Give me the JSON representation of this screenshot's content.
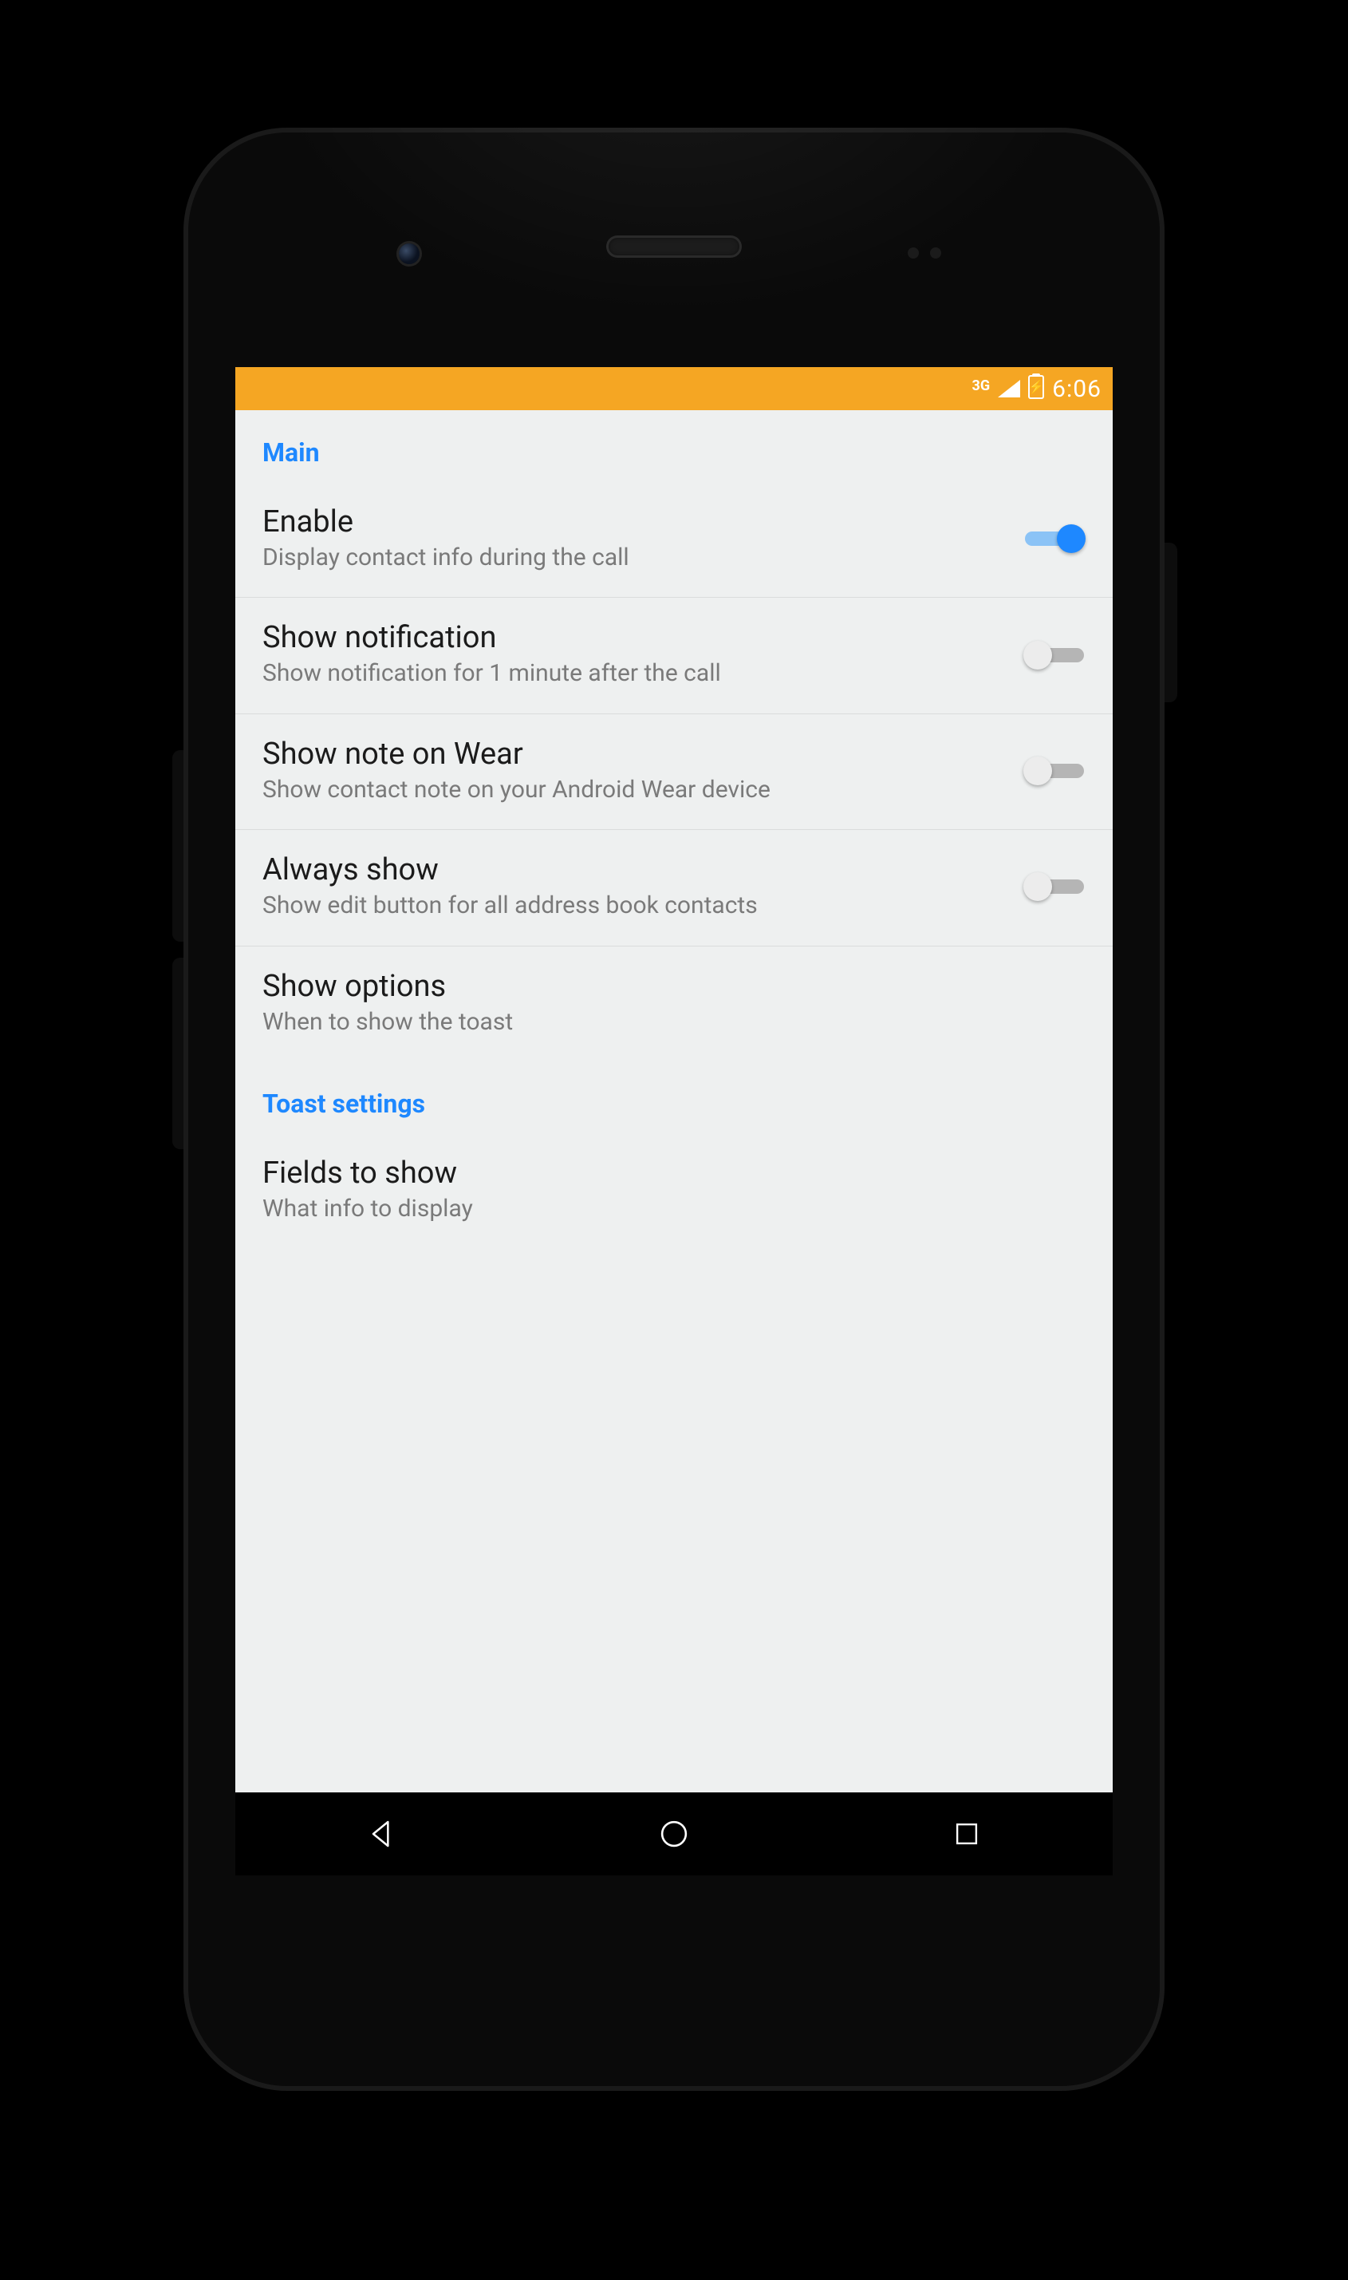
{
  "status_bar": {
    "network": "3G",
    "time": "6:06"
  },
  "sections": [
    {
      "header": "Main",
      "items": [
        {
          "title": "Enable",
          "subtitle": "Display contact info during the call",
          "on": true
        },
        {
          "title": "Show notification",
          "subtitle": "Show notification for 1 minute after the call",
          "on": false
        },
        {
          "title": "Show note on Wear",
          "subtitle": "Show contact note on your Android Wear device",
          "on": false
        },
        {
          "title": "Always show",
          "subtitle": "Show edit button for all address book contacts",
          "on": false
        },
        {
          "title": "Show options",
          "subtitle": "When to show the toast"
        }
      ]
    },
    {
      "header": "Toast settings",
      "items": [
        {
          "title": "Fields to show",
          "subtitle": "What info to display"
        }
      ]
    }
  ]
}
